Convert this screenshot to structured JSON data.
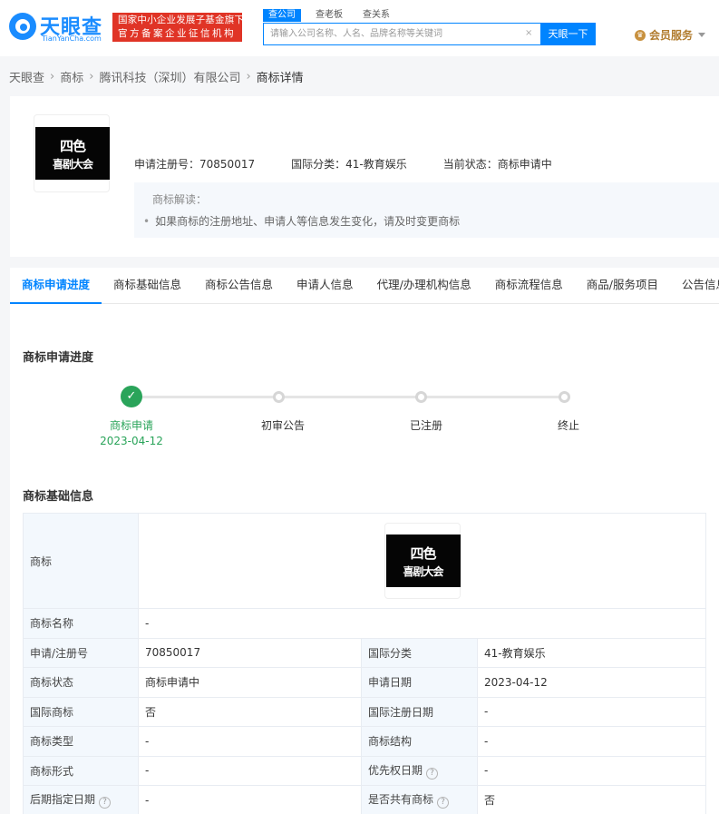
{
  "header": {
    "logo_cn": "天眼查",
    "logo_en": "TianYanCha.com",
    "badge_line1": "国家中小企业发展子基金旗下",
    "badge_line2": "官方备案企业征信机构",
    "search_tabs": [
      {
        "label": "查公司",
        "active": true
      },
      {
        "label": "查老板",
        "active": false
      },
      {
        "label": "查关系",
        "active": false
      }
    ],
    "search_placeholder": "请输入公司名称、人名、品牌名称等关键词",
    "search_clear": "×",
    "search_button": "天眼一下",
    "vip_label": "会员服务"
  },
  "breadcrumb": [
    "天眼查",
    "商标",
    "腾讯科技（深圳）有限公司",
    "商标详情"
  ],
  "trademark_art": {
    "line1": "四色",
    "line2": "喜剧大会"
  },
  "summary": {
    "reg_label": "申请注册号：",
    "reg_value": "70850017",
    "class_label": "国际分类：",
    "class_value": "41-教育娱乐",
    "status_label": "当前状态：",
    "status_value": "商标申请中",
    "interp_title": "商标解读：",
    "interp_item": "如果商标的注册地址、申请人等信息发生变化，请及时变更商标"
  },
  "tabs": [
    "商标申请进度",
    "商标基础信息",
    "商标公告信息",
    "申请人信息",
    "代理/办理机构信息",
    "商标流程信息",
    "商品/服务项目",
    "公告信息"
  ],
  "progress": {
    "title": "商标申请进度",
    "steps": [
      {
        "label": "商标申请",
        "date": "2023-04-12",
        "done": true
      },
      {
        "label": "初审公告",
        "date": "",
        "done": false
      },
      {
        "label": "已注册",
        "date": "",
        "done": false
      },
      {
        "label": "终止",
        "date": "",
        "done": false
      }
    ]
  },
  "basic_info": {
    "title": "商标基础信息",
    "logo_label": "商标",
    "name_label": "商标名称",
    "name_value": "-",
    "rows": [
      {
        "k1": "申请/注册号",
        "v1": "70850017",
        "k2": "国际分类",
        "v2": "41-教育娱乐"
      },
      {
        "k1": "商标状态",
        "v1": "商标申请中",
        "k2": "申请日期",
        "v2": "2023-04-12"
      },
      {
        "k1": "国际商标",
        "v1": "否",
        "k2": "国际注册日期",
        "v2": "-"
      },
      {
        "k1": "商标类型",
        "v1": "-",
        "k2": "商标结构",
        "v2": "-"
      },
      {
        "k1": "商标形式",
        "v1": "-",
        "k2": "优先权日期",
        "v2": "-"
      },
      {
        "k1": "后期指定日期",
        "v1": "-",
        "k2": "是否共有商标",
        "v2": "否"
      }
    ]
  }
}
